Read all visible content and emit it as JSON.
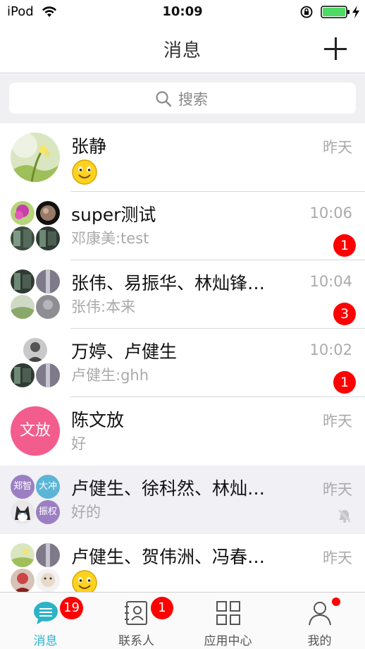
{
  "status_bar": {
    "carrier": "iPod",
    "time": "10:09"
  },
  "nav": {
    "title": "消息"
  },
  "search": {
    "placeholder": "搜索"
  },
  "conversations": [
    {
      "name": "张静",
      "preview": "",
      "preview_emoji": true,
      "time": "昨天",
      "badge": ""
    },
    {
      "name": "super测试",
      "preview": "邓康美:test",
      "time": "10:06",
      "badge": "1"
    },
    {
      "name": "张伟、易振华、林灿锋…",
      "preview": "张伟:本来",
      "time": "10:04",
      "badge": "3"
    },
    {
      "name": "万婷、卢健生",
      "preview": "卢健生:ghh",
      "time": "10:02",
      "badge": "1"
    },
    {
      "name": "陈文放",
      "preview": "好",
      "time": "昨天",
      "badge": "",
      "avatar_text": "文放"
    },
    {
      "name": "卢健生、徐科然、林灿…",
      "preview": "好的",
      "time": "昨天",
      "badge": "",
      "muted": true,
      "avatar_texts": [
        "郑智",
        "大冲",
        "振权"
      ]
    },
    {
      "name": "卢健生、贺伟洲、冯春…",
      "preview": "",
      "preview_emoji": true,
      "time": "昨天",
      "badge": ""
    }
  ],
  "tabs": [
    {
      "label": "消息",
      "badge": "19",
      "icon": "chat-bubble-icon",
      "active": true
    },
    {
      "label": "联系人",
      "badge": "1",
      "icon": "contacts-book-icon"
    },
    {
      "label": "应用中心",
      "icon": "grid-apps-icon"
    },
    {
      "label": "我的",
      "icon": "person-icon",
      "dot": true
    }
  ],
  "colors": {
    "accent": "#2bb3c8",
    "badge": "#ff0000",
    "text_avatar": "#f25d8e",
    "group_text_avatar": "#9b7fc2"
  }
}
